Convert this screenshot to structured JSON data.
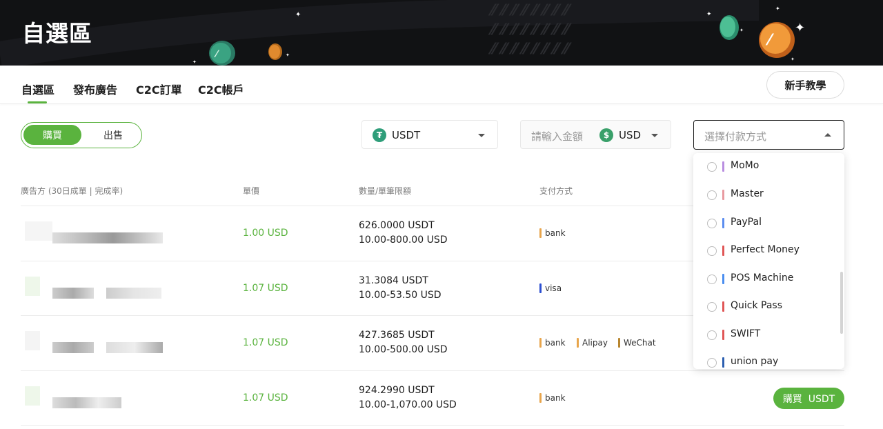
{
  "banner": {
    "title": "自選區"
  },
  "nav": {
    "tabs": [
      "自選區",
      "發布廣告",
      "C2C訂單",
      "C2C帳戶"
    ],
    "guide_button": "新手教學"
  },
  "trade_toggle": {
    "buy": "購買",
    "sell": "出售"
  },
  "filters": {
    "crypto": {
      "value": "USDT",
      "icon_char": "₮"
    },
    "amount": {
      "placeholder": "請輸入金額",
      "currency": "USD",
      "icon_char": "$"
    },
    "payment": {
      "placeholder": "選擇付款方式"
    }
  },
  "table": {
    "headers": {
      "advertiser": "廣告方 (30日成單 | 完成率)",
      "price": "單價",
      "quantity": "數量/單筆限額",
      "payment": "支付方式"
    },
    "rows": [
      {
        "price": "1.00 USD",
        "amount": "626.0000 USDT",
        "limit": "10.00-800.00 USD",
        "methods": [
          {
            "name": "bank",
            "color": "#e8a54b"
          }
        ]
      },
      {
        "price": "1.07 USD",
        "amount": "31.3084 USDT",
        "limit": "10.00-53.50 USD",
        "methods": [
          {
            "name": "visa",
            "color": "#2c4fd1"
          }
        ]
      },
      {
        "price": "1.07 USD",
        "amount": "427.3685 USDT",
        "limit": "10.00-500.00 USD",
        "methods": [
          {
            "name": "bank",
            "color": "#e8a54b"
          },
          {
            "name": "Alipay",
            "color": "#e8a54b"
          },
          {
            "name": "WeChat",
            "color": "#b8862f"
          }
        ]
      },
      {
        "price": "1.07 USD",
        "amount": "924.2990 USDT",
        "limit": "10.00-1,070.00 USD",
        "methods": [
          {
            "name": "bank",
            "color": "#e8a54b"
          }
        ],
        "action": "購買  USDT"
      }
    ]
  },
  "payment_dropdown": {
    "items": [
      {
        "label": "MoMo",
        "color": "#b98ee0"
      },
      {
        "label": "Master",
        "color": "#e89aa0"
      },
      {
        "label": "PayPal",
        "color": "#5b8def"
      },
      {
        "label": "Perfect Money",
        "color": "#e05656"
      },
      {
        "label": "POS Machine",
        "color": "#4a8ef0"
      },
      {
        "label": "Quick Pass",
        "color": "#e05656"
      },
      {
        "label": "SWIFT",
        "color": "#e05656"
      },
      {
        "label": "union pay",
        "color": "#2c5fb0"
      }
    ]
  },
  "colors": {
    "accent": "#5ab33e",
    "banner_bg": "#111214"
  }
}
